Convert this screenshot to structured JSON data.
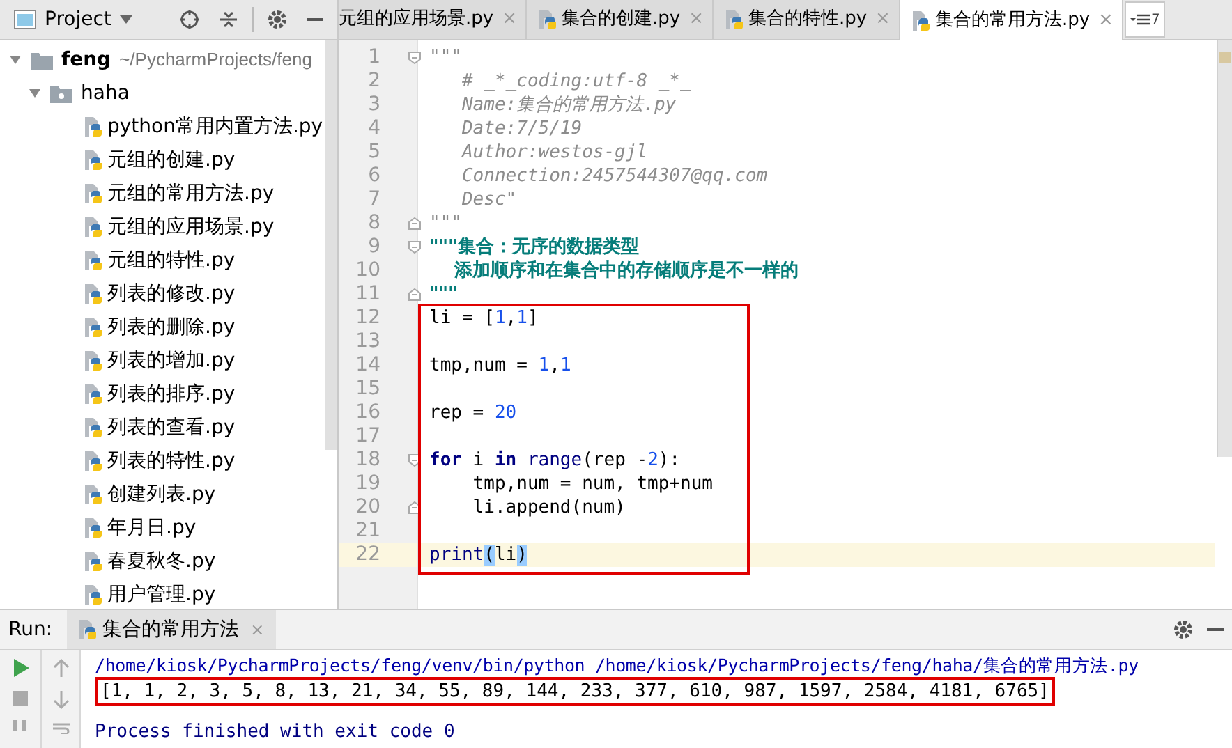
{
  "project_panel": {
    "title": "Project",
    "tree": [
      {
        "name": "feng",
        "path": "~/PycharmProjects/feng",
        "kind": "root",
        "expanded": true,
        "children": [
          {
            "name": "haha",
            "kind": "package",
            "expanded": true,
            "children": [
              {
                "name": "python常用内置方法.py",
                "kind": "file"
              },
              {
                "name": "元组的创建.py",
                "kind": "file"
              },
              {
                "name": "元组的常用方法.py",
                "kind": "file"
              },
              {
                "name": "元组的应用场景.py",
                "kind": "file"
              },
              {
                "name": "元组的特性.py",
                "kind": "file"
              },
              {
                "name": "列表的修改.py",
                "kind": "file"
              },
              {
                "name": "列表的删除.py",
                "kind": "file"
              },
              {
                "name": "列表的增加.py",
                "kind": "file"
              },
              {
                "name": "列表的排序.py",
                "kind": "file"
              },
              {
                "name": "列表的查看.py",
                "kind": "file"
              },
              {
                "name": "列表的特性.py",
                "kind": "file"
              },
              {
                "name": "创建列表.py",
                "kind": "file"
              },
              {
                "name": "年月日.py",
                "kind": "file"
              },
              {
                "name": "春夏秋冬.py",
                "kind": "file"
              },
              {
                "name": "用户管理.py",
                "kind": "file"
              }
            ]
          }
        ]
      }
    ]
  },
  "tabs": [
    {
      "label": "元组的应用场景.py",
      "selected": false,
      "close": "×"
    },
    {
      "label": "集合的创建.py",
      "selected": false,
      "close": "×"
    },
    {
      "label": "集合的特性.py",
      "selected": false,
      "close": "×"
    },
    {
      "label": "集合的常用方法.py",
      "selected": true,
      "close": "×"
    }
  ],
  "tab_overflow": "7",
  "editor": {
    "lines": [
      {
        "number": "1",
        "kind": "opener",
        "current": false,
        "tokens": [
          {
            "kind": "comment",
            "text": "\"\"\""
          }
        ]
      },
      {
        "number": "2",
        "current": false,
        "tokens": [
          {
            "kind": "comment",
            "text": "   # _*_coding:utf-8 _*_"
          }
        ]
      },
      {
        "number": "3",
        "current": false,
        "tokens": [
          {
            "kind": "comment",
            "text": "   Name:集合的常用方法.py"
          }
        ]
      },
      {
        "number": "4",
        "current": false,
        "tokens": [
          {
            "kind": "comment",
            "text": "   Date:7/5/19"
          }
        ]
      },
      {
        "number": "5",
        "current": false,
        "tokens": [
          {
            "kind": "comment",
            "text": "   Author:westos-gjl"
          }
        ]
      },
      {
        "number": "6",
        "current": false,
        "tokens": [
          {
            "kind": "comment",
            "text": "   Connection:2457544307@qq.com"
          }
        ]
      },
      {
        "number": "7",
        "current": false,
        "tokens": [
          {
            "kind": "comment",
            "text": "   Desc\""
          }
        ]
      },
      {
        "number": "8",
        "kind": "closer",
        "current": false,
        "tokens": [
          {
            "kind": "comment",
            "text": "\"\"\""
          }
        ]
      },
      {
        "number": "9",
        "kind": "opener",
        "current": false,
        "tokens": [
          {
            "kind": "docstring",
            "text": "\"\"\"集合：无序的数据类型"
          }
        ]
      },
      {
        "number": "10",
        "current": false,
        "tokens": [
          {
            "kind": "docstring",
            "text": "    添加顺序和在集合中的存储顺序是不一样的"
          }
        ]
      },
      {
        "number": "11",
        "kind": "closer",
        "current": false,
        "tokens": [
          {
            "kind": "docstring",
            "text": "\"\"\""
          }
        ]
      },
      {
        "number": "12",
        "current": false,
        "tokens": [
          {
            "kind": "plain",
            "text": "li = ["
          },
          {
            "kind": "number",
            "text": "1"
          },
          {
            "kind": "plain",
            "text": ","
          },
          {
            "kind": "number",
            "text": "1"
          },
          {
            "kind": "plain",
            "text": "]"
          }
        ]
      },
      {
        "number": "13",
        "current": false
      },
      {
        "number": "14",
        "current": false,
        "tokens": [
          {
            "kind": "plain",
            "text": "tmp,num = "
          },
          {
            "kind": "number",
            "text": "1"
          },
          {
            "kind": "plain",
            "text": ","
          },
          {
            "kind": "number",
            "text": "1"
          }
        ]
      },
      {
        "number": "15",
        "current": false
      },
      {
        "number": "16",
        "current": false,
        "tokens": [
          {
            "kind": "plain",
            "text": "rep = "
          },
          {
            "kind": "number",
            "text": "20"
          }
        ]
      },
      {
        "number": "17",
        "current": false
      },
      {
        "number": "18",
        "kind": "opener",
        "current": false,
        "tokens": [
          {
            "kind": "keyword",
            "text": "for"
          },
          {
            "kind": "plain",
            "text": " i "
          },
          {
            "kind": "keyword",
            "text": "in "
          },
          {
            "kind": "builtin",
            "text": "range"
          },
          {
            "kind": "plain",
            "text": "(rep -"
          },
          {
            "kind": "number",
            "text": "2"
          },
          {
            "kind": "plain",
            "text": "):"
          }
        ]
      },
      {
        "number": "19",
        "current": false,
        "tokens": [
          {
            "kind": "plain",
            "text": "    tmp,num = num, tmp+num"
          }
        ]
      },
      {
        "number": "20",
        "kind": "closer",
        "current": false,
        "tokens": [
          {
            "kind": "plain",
            "text": "    li.append(num)"
          }
        ]
      },
      {
        "number": "21",
        "current": false
      },
      {
        "number": "22",
        "current": true,
        "tokens": [
          {
            "kind": "builtin",
            "text": "print"
          },
          {
            "kind": "brace",
            "text": "("
          },
          {
            "kind": "plain",
            "text": "li"
          },
          {
            "kind": "brace",
            "text": ")"
          }
        ]
      }
    ]
  },
  "run_panel": {
    "label": "Run:",
    "tab": "集合的常用方法",
    "close": "×",
    "output": [
      {
        "kind": "command",
        "text": "/home/kiosk/PycharmProjects/feng/venv/bin/python /home/kiosk/PycharmProjects/feng/haha/集合的常用方法.py"
      },
      {
        "kind": "result",
        "text": "[1, 1, 2, 3, 5, 8, 13, 21, 34, 55, 89, 144, 233, 377, 610, 987, 1597, 2584, 4181, 6765]"
      },
      {
        "kind": "status",
        "text": "Process finished with exit code 0"
      }
    ]
  }
}
